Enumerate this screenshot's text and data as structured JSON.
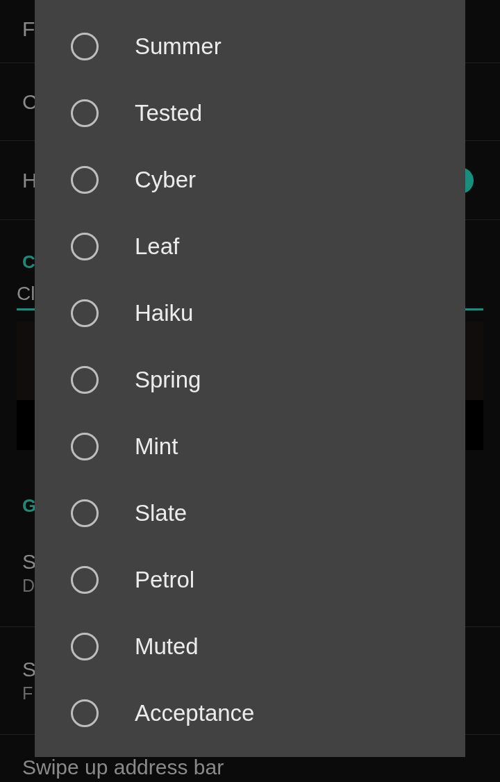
{
  "settings": [
    {
      "kind": "row",
      "title": "F"
    },
    {
      "kind": "row",
      "title": "C"
    },
    {
      "kind": "toggle",
      "title": "H",
      "on": true
    },
    {
      "kind": "header",
      "title": "C"
    },
    {
      "kind": "field",
      "value": "Cl"
    },
    {
      "kind": "preview"
    },
    {
      "kind": "header",
      "title": "G"
    },
    {
      "kind": "row",
      "title": "S",
      "subtitle": "D"
    },
    {
      "kind": "row",
      "title": "S",
      "subtitle": "F"
    },
    {
      "kind": "row",
      "title": "Swipe up address bar"
    }
  ],
  "dialog": {
    "options": [
      {
        "label": "Summer",
        "selected": false
      },
      {
        "label": "Tested",
        "selected": false
      },
      {
        "label": "Cyber",
        "selected": false
      },
      {
        "label": "Leaf",
        "selected": false
      },
      {
        "label": "Haiku",
        "selected": false
      },
      {
        "label": "Spring",
        "selected": false
      },
      {
        "label": "Mint",
        "selected": false
      },
      {
        "label": "Slate",
        "selected": false
      },
      {
        "label": "Petrol",
        "selected": false
      },
      {
        "label": "Muted",
        "selected": false
      },
      {
        "label": "Acceptance",
        "selected": false
      }
    ]
  }
}
